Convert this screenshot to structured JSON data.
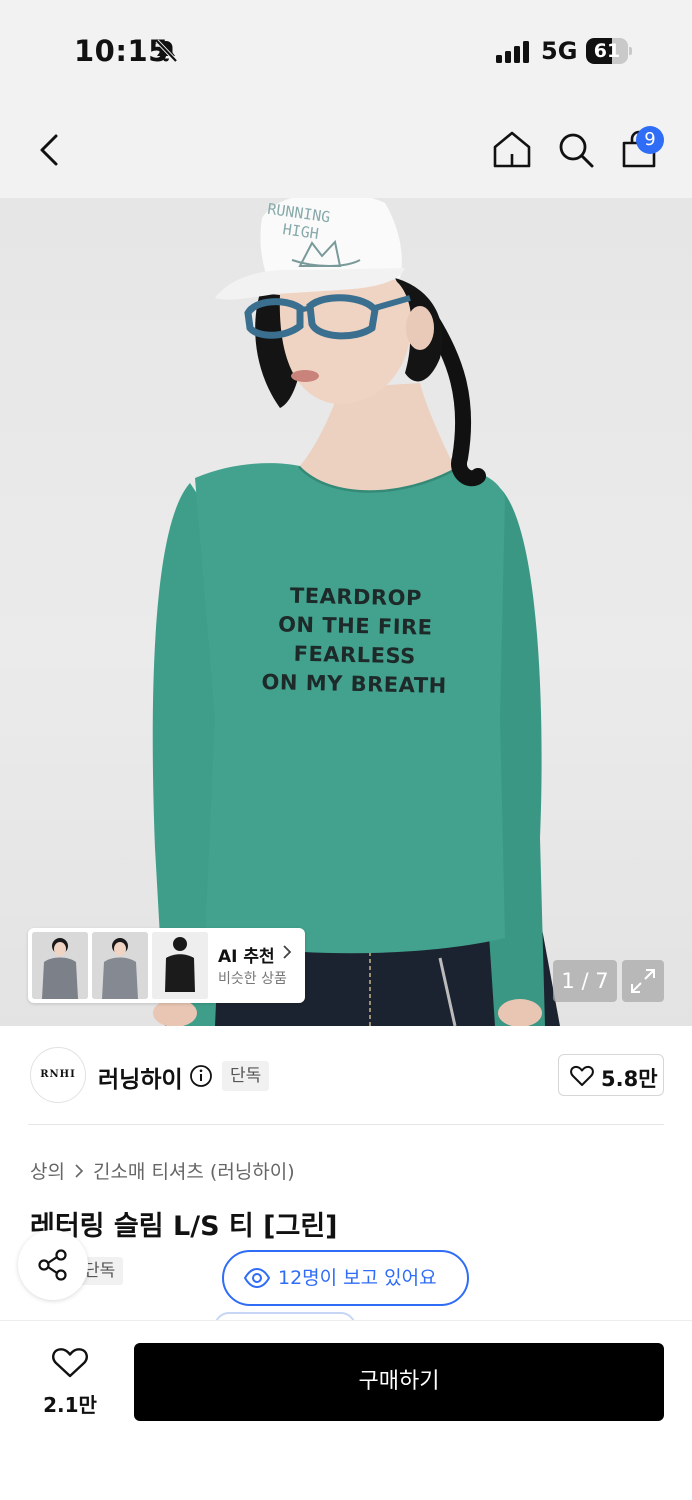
{
  "status_bar": {
    "time": "10:15",
    "network": "5G",
    "battery": "61",
    "battery_level": 0.61
  },
  "nav": {
    "bag_badge_count": "9"
  },
  "hero": {
    "shirt_print": [
      "TEARDROP",
      "ON THE FIRE",
      "FEARLESS",
      "ON MY BREATH"
    ],
    "cap_text": [
      "RUNNING",
      "HIGH"
    ],
    "ai_recommend": {
      "title": "AI 추천",
      "subtitle": "비슷한 상품"
    },
    "page_indicator": "1 / 7"
  },
  "brand": {
    "logo_text": "RNHI",
    "name": "러닝하이",
    "exclusive_tag": "단독",
    "like_count": "5.8만"
  },
  "product": {
    "category_primary": "상의",
    "category_secondary": "긴소매 티셔츠 (러닝하이)",
    "title": "레터링 슬림 L/S 티 [그린]",
    "exclusive_tag": "단독",
    "viewers_text": "12명이 보고 있어요"
  },
  "bottom_bar": {
    "like_count": "2.1만",
    "buy_label": "구매하기"
  },
  "colors": {
    "accent": "#2f6df6",
    "shirt": "#3f9e8a",
    "buy_button": "#000000"
  },
  "icons": [
    "bell-slash-icon",
    "signal-icon",
    "battery-icon",
    "back-icon",
    "home-icon",
    "search-icon",
    "shopping-bag-icon",
    "info-icon",
    "heart-icon",
    "share-icon",
    "eye-icon",
    "expand-icon",
    "chevron-right-icon"
  ]
}
